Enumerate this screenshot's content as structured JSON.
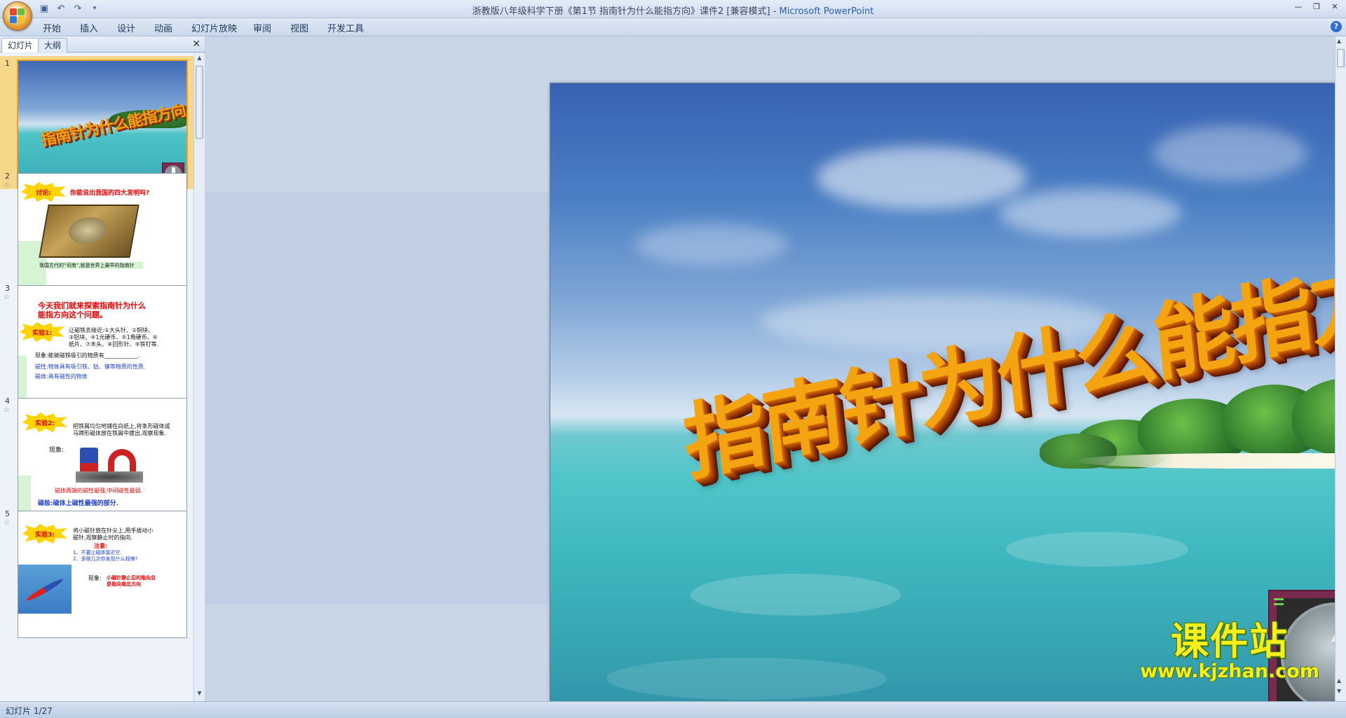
{
  "window": {
    "title": "浙教版八年级科学下册《第1节 指南针为什么能指方向》课件2 [兼容模式] - ",
    "app_name": "Microsoft PowerPoint"
  },
  "ribbon": {
    "tabs": [
      "开始",
      "插入",
      "设计",
      "动画",
      "幻灯片放映",
      "审阅",
      "视图",
      "开发工具"
    ]
  },
  "panel": {
    "tabs": [
      "幻灯片",
      "大纲"
    ],
    "slides": [
      {
        "number": "1",
        "wordart": "指南针为什么能指方向"
      },
      {
        "number": "2",
        "burst": "讨论:",
        "title": "你能说出我国的四大发明吗?",
        "caption": "我国古代的“司南”,就是世界上最早的指南针"
      },
      {
        "number": "3",
        "title_lines": [
          "今天我们就来探索指南针为什么",
          "能指方向这个问题。"
        ],
        "burst": "实验1:",
        "lines": [
          "让磁铁去接近:①大头针、②铜块、",
          "③铝块、④1元硬币、⑤1角硬币、⑥",
          "纸片、⑦木头、⑧回形针、⑨铁钉等."
        ],
        "obs": "现象:能被磁铁吸引的物质有____________.",
        "defs": [
          "磁性:物体具有吸引铁、钴、镍等物质的性质.",
          "磁体:具有磁性的物体"
        ]
      },
      {
        "number": "4",
        "burst": "实验2:",
        "lines": [
          "把铁屑均匀地铺在白纸上,将条形磁体或",
          "马蹄形磁体放在铁屑中拔出,观察现象."
        ],
        "obs_label": "现象:",
        "red": "磁体两端的磁性最强,中间磁性最弱.",
        "blue": "磁极:磁体上磁性最强的部分."
      },
      {
        "number": "5",
        "burst": "实验3:",
        "lines": [
          "将小磁针放在针尖上,用手拨动小",
          "磁针,观察静止时的指向."
        ],
        "note": "注意:",
        "notes": [
          "1、不要让磁体靠近它.",
          "2、多做几次你发现什么规律?"
        ],
        "obs_label": "现象:",
        "obs_red": [
          "小磁针静止后的指向总",
          "是指向南北方向"
        ]
      }
    ]
  },
  "slide": {
    "wordart": "指南针为什么能指方向",
    "watermark": {
      "cn": "课件站",
      "url": "www.kjzhan.com"
    }
  },
  "status": {
    "slide_counter": "幻灯片 1/27"
  }
}
